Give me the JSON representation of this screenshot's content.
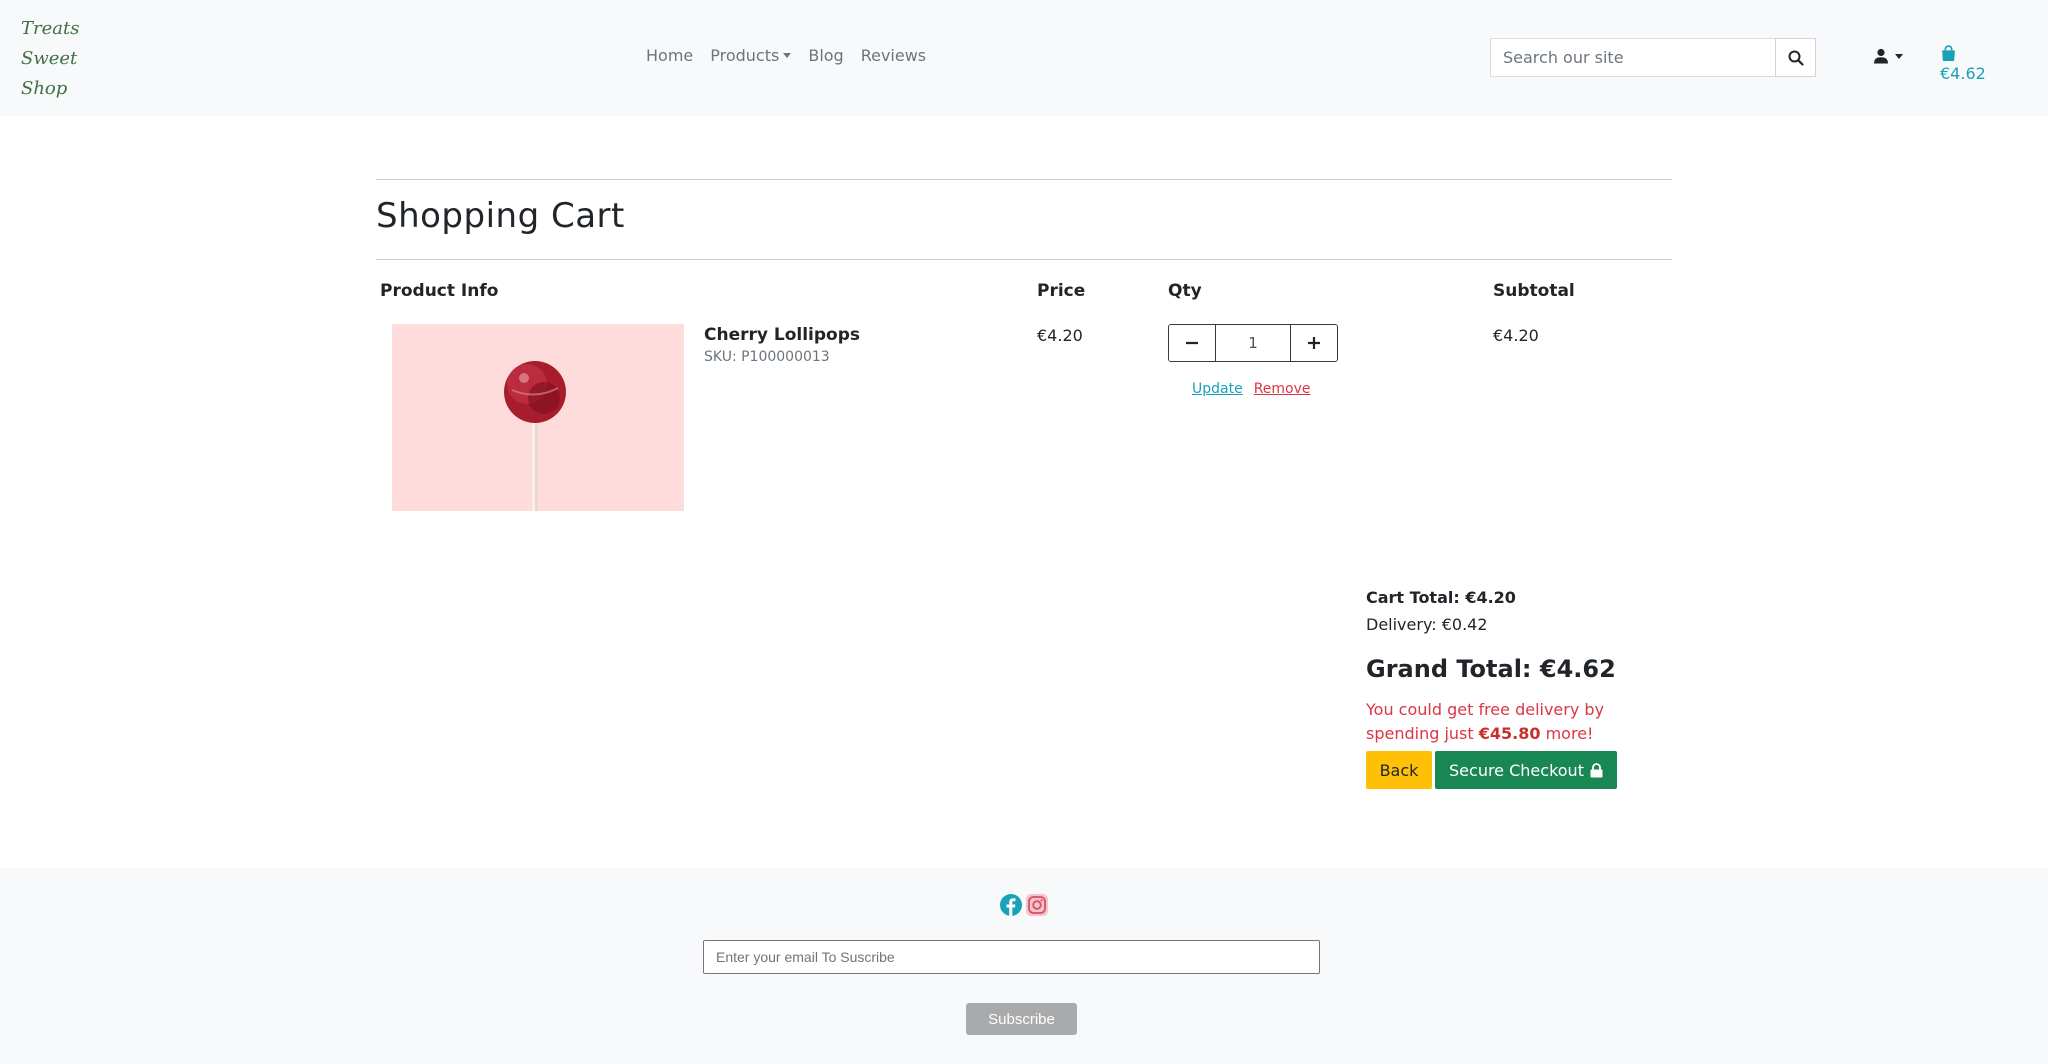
{
  "brand": {
    "line1": "Treats",
    "line2": "Sweet",
    "line3": "Shop"
  },
  "nav": {
    "home": "Home",
    "products": "Products",
    "blog": "Blog",
    "reviews": "Reviews"
  },
  "search": {
    "placeholder": "Search our site",
    "icon": "search-icon"
  },
  "header": {
    "account_icon": "user-icon",
    "bag_icon": "shopping-bag-icon",
    "bag_total": "€4.62"
  },
  "cart": {
    "title": "Shopping Cart",
    "columns": {
      "product_info": "Product Info",
      "price": "Price",
      "qty": "Qty",
      "subtotal": "Subtotal"
    },
    "items": [
      {
        "name": "Cherry Lollipops",
        "sku": "SKU: P100000013",
        "price": "€4.20",
        "quantity": "1",
        "subtotal": "€4.20",
        "update_label": "Update",
        "remove_label": "Remove"
      }
    ],
    "cart_total": "Cart Total: €4.20",
    "delivery": "Delivery: €0.42",
    "grand_total": "Grand Total: €4.62",
    "free_delivery_prefix": "You could get free delivery by spending just ",
    "free_delivery_amount": "€45.80",
    "free_delivery_suffix": " more!",
    "back_label": "Back",
    "checkout_label": "Secure Checkout"
  },
  "footer": {
    "email_placeholder": "Enter your email To Suscribe",
    "subscribe_label": "Subscribe"
  },
  "colors": {
    "accent": "#17a2b8",
    "danger": "#dc3545",
    "back": "#ffc107",
    "checkout": "#198754",
    "logo": "#3f6f46"
  }
}
